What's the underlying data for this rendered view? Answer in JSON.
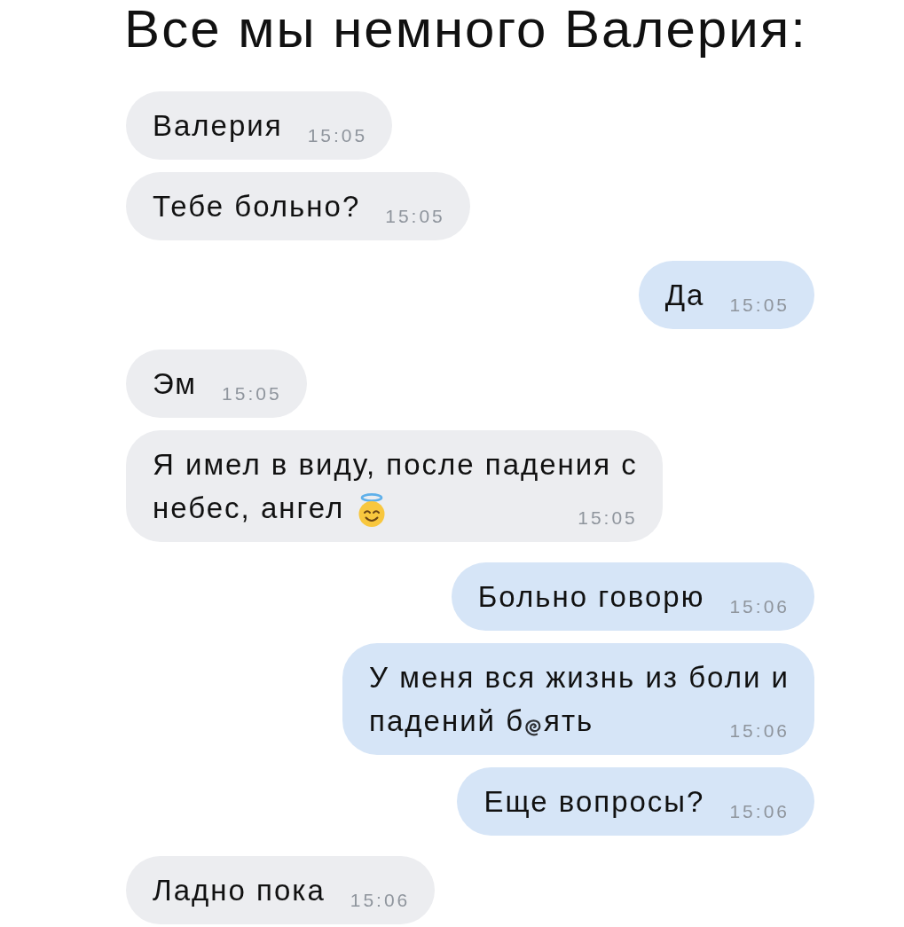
{
  "title": "Все мы немного Валерия:",
  "messages": [
    {
      "outgoing": false,
      "lines": [
        {
          "parts": [
            {
              "kind": "text",
              "text": "Валерия"
            }
          ]
        }
      ],
      "time": "15:05"
    },
    {
      "outgoing": false,
      "lines": [
        {
          "parts": [
            {
              "kind": "text",
              "text": "Тебе больно?"
            }
          ]
        }
      ],
      "time": "15:05"
    },
    {
      "outgoing": true,
      "lines": [
        {
          "parts": [
            {
              "kind": "text",
              "text": "Да"
            }
          ]
        }
      ],
      "time": "15:05"
    },
    {
      "outgoing": false,
      "lines": [
        {
          "parts": [
            {
              "kind": "text",
              "text": "Эм"
            }
          ]
        }
      ],
      "time": "15:05"
    },
    {
      "outgoing": false,
      "lines": [
        {
          "parts": [
            {
              "kind": "text",
              "text": "Я имел в виду, после падения с"
            }
          ]
        },
        {
          "parts": [
            {
              "kind": "text",
              "text": "небес, ангел"
            },
            {
              "kind": "emoji"
            }
          ]
        }
      ],
      "time": "15:05"
    },
    {
      "outgoing": true,
      "lines": [
        {
          "parts": [
            {
              "kind": "text",
              "text": "Больно говорю"
            }
          ]
        }
      ],
      "time": "15:06"
    },
    {
      "outgoing": true,
      "lines": [
        {
          "parts": [
            {
              "kind": "text",
              "text": "У меня вся жизнь из боли и"
            }
          ]
        },
        {
          "parts": [
            {
              "kind": "text",
              "text": "падений б"
            },
            {
              "kind": "censor"
            },
            {
              "kind": "text",
              "text": "ять"
            }
          ]
        }
      ],
      "time": "15:06"
    },
    {
      "outgoing": true,
      "lines": [
        {
          "parts": [
            {
              "kind": "text",
              "text": "Еще вопросы?"
            }
          ]
        }
      ],
      "time": "15:06"
    },
    {
      "outgoing": false,
      "lines": [
        {
          "parts": [
            {
              "kind": "text",
              "text": "Ладно пока"
            }
          ]
        }
      ],
      "time": "15:06"
    }
  ]
}
